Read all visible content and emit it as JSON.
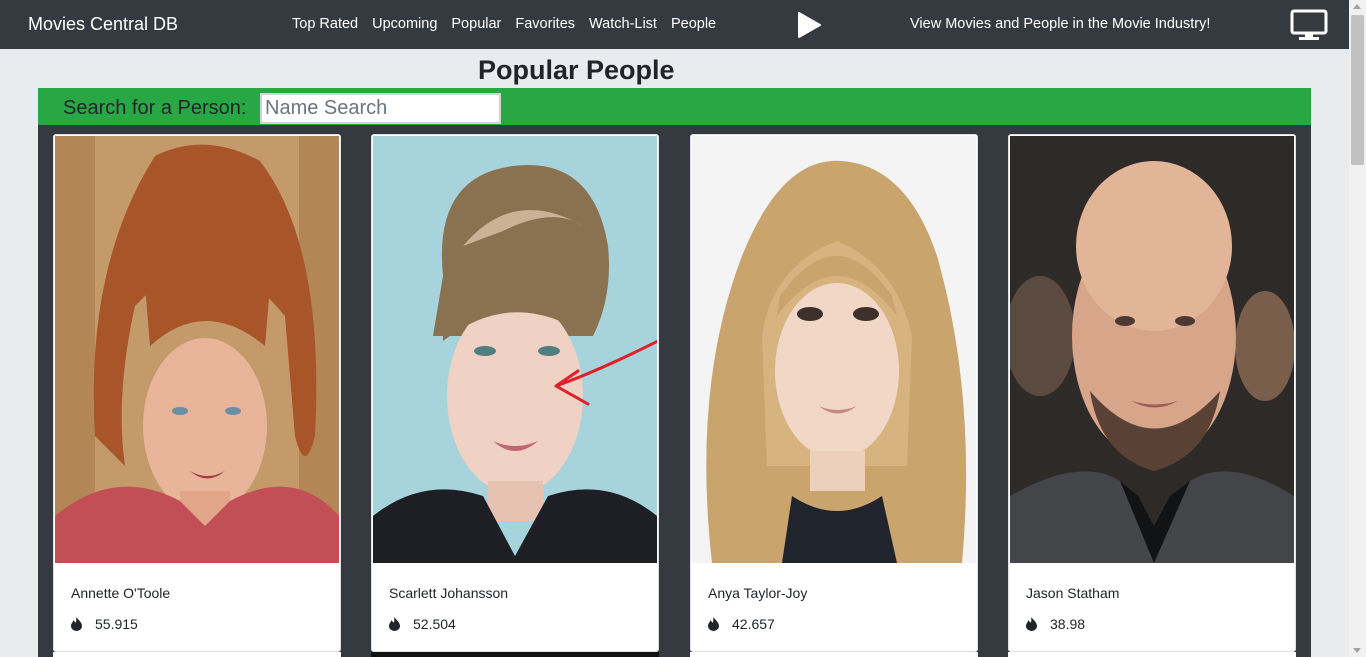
{
  "navbar": {
    "brand": "Movies Central DB",
    "links": [
      "Top Rated",
      "Upcoming",
      "Popular",
      "Favorites",
      "Watch-List",
      "People"
    ],
    "tagline": "View Movies and People in the Movie Industry!",
    "play_icon": "play-icon",
    "tv_icon": "tv-icon"
  },
  "page": {
    "title": "Popular People"
  },
  "search": {
    "label": "Search for a Person:",
    "placeholder": "Name Search",
    "value": ""
  },
  "people": [
    {
      "name": "Annette O'Toole",
      "popularity": "55.915"
    },
    {
      "name": "Scarlett Johansson",
      "popularity": "52.504"
    },
    {
      "name": "Anya Taylor-Joy",
      "popularity": "42.657"
    },
    {
      "name": "Jason Statham",
      "popularity": "38.98"
    }
  ],
  "colors": {
    "navbar_bg": "#343a40",
    "search_bar_bg": "#28a745",
    "page_bg": "#e9ecef",
    "annotation_arrow": "#e0202a"
  }
}
